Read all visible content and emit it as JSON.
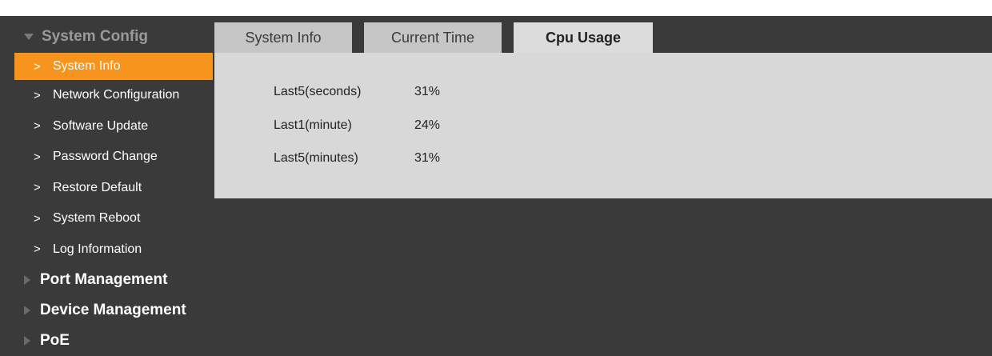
{
  "sidebar": {
    "system_config": "System Config",
    "items": [
      {
        "label": "System Info"
      },
      {
        "label": "Network Configuration"
      },
      {
        "label": "Software Update"
      },
      {
        "label": "Password Change"
      },
      {
        "label": "Restore Default"
      },
      {
        "label": "System Reboot"
      },
      {
        "label": "Log Information"
      }
    ],
    "active_item": "System Info",
    "sections": [
      {
        "label": "Port Management"
      },
      {
        "label": "Device Management"
      },
      {
        "label": "PoE"
      }
    ]
  },
  "tabs": [
    {
      "label": "System Info"
    },
    {
      "label": "Current Time"
    },
    {
      "label": "Cpu Usage"
    }
  ],
  "active_tab": "Cpu Usage",
  "cpu_usage": [
    {
      "label": "Last5(seconds)",
      "value": "31%"
    },
    {
      "label": "Last1(minute)",
      "value": "24%"
    },
    {
      "label": "Last5(minutes)",
      "value": "31%"
    }
  ],
  "colors": {
    "accent": "#f7941d",
    "background": "#3a3a3a",
    "panel": "#d8d8d8",
    "tab": "#c6c6c6",
    "tab_active": "#dcdcdc"
  },
  "icons": {
    "expanded": "triangle-down-icon",
    "collapsed": "triangle-right-icon",
    "item": "chevron-right-icon"
  }
}
